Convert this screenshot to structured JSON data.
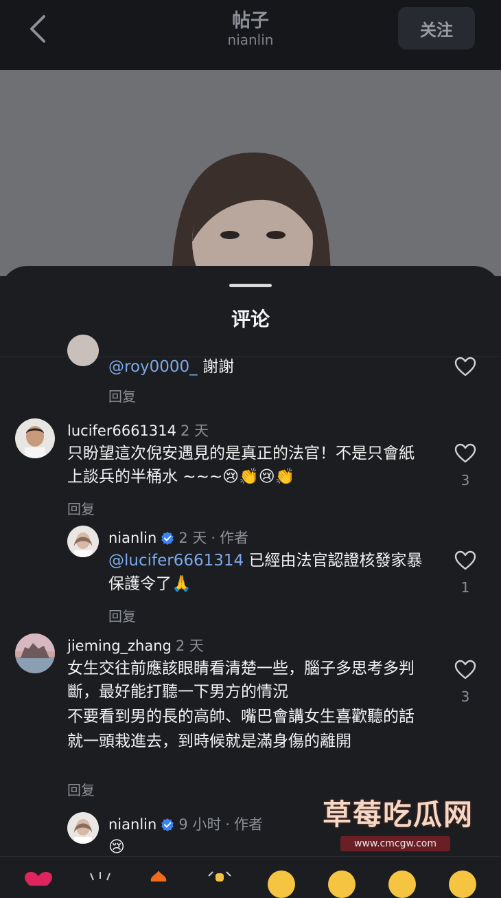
{
  "header": {
    "title": "帖子",
    "subtitle": "nianlin",
    "follow_label": "关注"
  },
  "sheet": {
    "title": "评论"
  },
  "comments": [
    {
      "text_mention": "@roy0000_",
      "text": " 謝謝",
      "reply_label": "回复"
    },
    {
      "username": "lucifer6661314",
      "time": "2 天",
      "text": "只盼望這次倪安遇見的是真正的法官！不是只會紙上談兵的半桶水 ~~~😢👏😢👏",
      "reply_label": "回复",
      "likes": "3"
    },
    {
      "username": "nianlin",
      "time": "2 天",
      "author_tag": "作者",
      "text_mention": "@lucifer6661314",
      "text": " 已經由法官認證核發家暴保護令了🙏",
      "reply_label": "回复",
      "likes": "1"
    },
    {
      "username": "jieming_zhang",
      "time": "2 天",
      "text_lines": [
        "女生交往前應該眼睛看清楚一些，腦子多思考多判斷，最好能打聽一下男方的情況",
        "不要看到男的長的高帥、嘴巴會講女生喜歡聽的話",
        "就一頭栽進去，到時候就是滿身傷的離開"
      ],
      "reply_label": "回复",
      "likes": "3"
    },
    {
      "username": "nianlin",
      "time": "9 小时",
      "author_tag": "作者",
      "text": "😢"
    }
  ],
  "watermark": {
    "main": "草莓吃瓜网",
    "sub": "www.cmcgw.com"
  },
  "colors": {
    "background": "#1b1d21",
    "mention": "#7fa8e8",
    "verified": "#3b82f6"
  }
}
